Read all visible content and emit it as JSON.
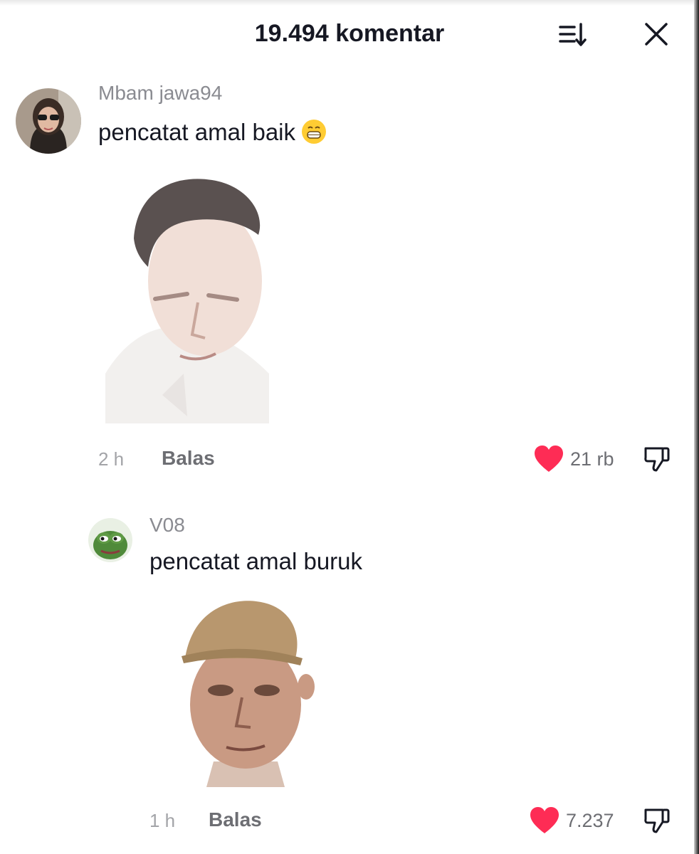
{
  "header": {
    "title": "19.494 komentar",
    "sort_icon": "sort-icon",
    "close_icon": "close-icon"
  },
  "comments": [
    {
      "username": "Mbam jawa94",
      "text": "pencatat amal baik",
      "emoji": "grinning-emoji",
      "time": "2 h",
      "reply_label": "Balas",
      "likes": "21 rb"
    },
    {
      "username": "V08",
      "text": "pencatat amal buruk",
      "time": "1 h",
      "reply_label": "Balas",
      "likes": "7.237"
    }
  ],
  "colors": {
    "heart": "#fe2c55",
    "text": "#161823",
    "muted": "#8a8b91"
  }
}
